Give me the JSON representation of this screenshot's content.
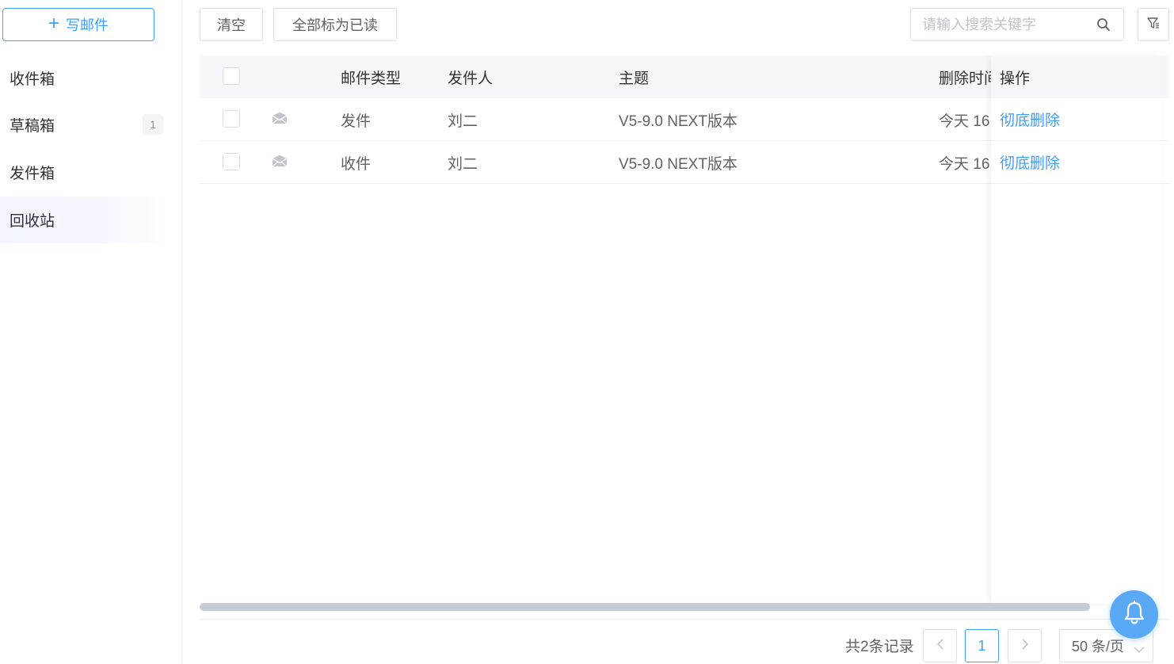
{
  "sidebar": {
    "compose_label": "写邮件",
    "folders": [
      {
        "label": "收件箱",
        "badge": ""
      },
      {
        "label": "草稿箱",
        "badge": "1"
      },
      {
        "label": "发件箱",
        "badge": ""
      },
      {
        "label": "回收站",
        "badge": "",
        "active": true
      }
    ]
  },
  "toolbar": {
    "clear_label": "清空",
    "mark_all_read_label": "全部标为已读",
    "search_placeholder": "请输入搜索关键字"
  },
  "table": {
    "columns": {
      "type": "邮件类型",
      "sender": "发件人",
      "subject": "主题",
      "deleted_time": "删除时间",
      "action": "操作"
    },
    "rows": [
      {
        "type": "发件",
        "sender": "刘二",
        "subject": "V5-9.0 NEXT版本",
        "deleted_time": "今天 16",
        "action": "彻底删除"
      },
      {
        "type": "收件",
        "sender": "刘二",
        "subject": "V5-9.0 NEXT版本",
        "deleted_time": "今天 16",
        "action": "彻底删除"
      }
    ]
  },
  "pagination": {
    "total_text": "共2条记录",
    "current_page": "1",
    "page_size": "50 条/页"
  },
  "colors": {
    "accent": "#409eff",
    "bell": "#5aa9f7"
  },
  "icons": {
    "compose": "plus-icon",
    "search": "search-icon",
    "filter": "filter-icon",
    "mail": "envelope-icon",
    "prev": "chevron-left-icon",
    "next": "chevron-right-icon",
    "dropdown": "chevron-down-icon",
    "notify": "bell-icon"
  }
}
